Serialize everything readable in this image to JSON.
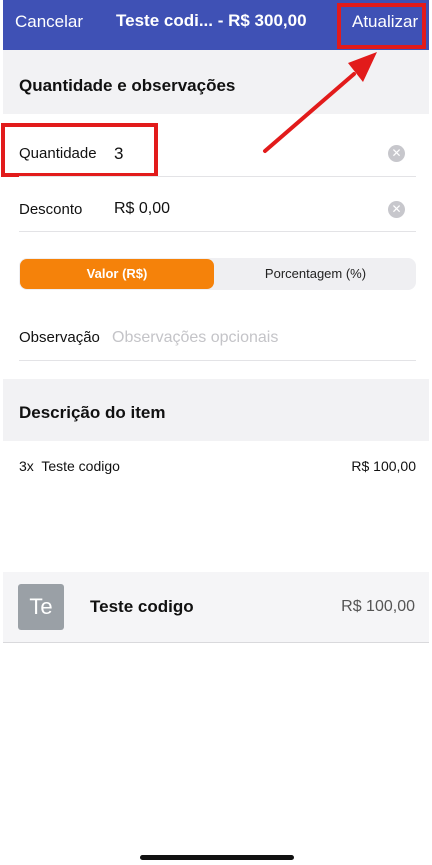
{
  "navbar": {
    "cancel_label": "Cancelar",
    "title": "Teste codi... - R$ 300,00",
    "update_label": "Atualizar",
    "background_color": "#3f51b5"
  },
  "quantity_section": {
    "header": "Quantidade e observações",
    "quantity_label": "Quantidade",
    "quantity_value": "3",
    "discount_label": "Desconto",
    "discount_value": "R$ 0,00",
    "discount_mode": {
      "options": [
        "Valor (R$)",
        "Porcentagem (%)"
      ],
      "selected": "Valor (R$)",
      "active_color": "#f5820a"
    },
    "observation_label": "Observação",
    "observation_value": "",
    "observation_placeholder": "Observações opcionais"
  },
  "item_section": {
    "header": "Descrição do item",
    "summary_qty_name": "3x  Teste codigo",
    "summary_price": "R$ 100,00"
  },
  "product": {
    "thumbnail_text": "Te",
    "name": "Teste codigo",
    "price": "R$ 100,00"
  },
  "annotations": {
    "highlight_color": "#e21b1b"
  }
}
